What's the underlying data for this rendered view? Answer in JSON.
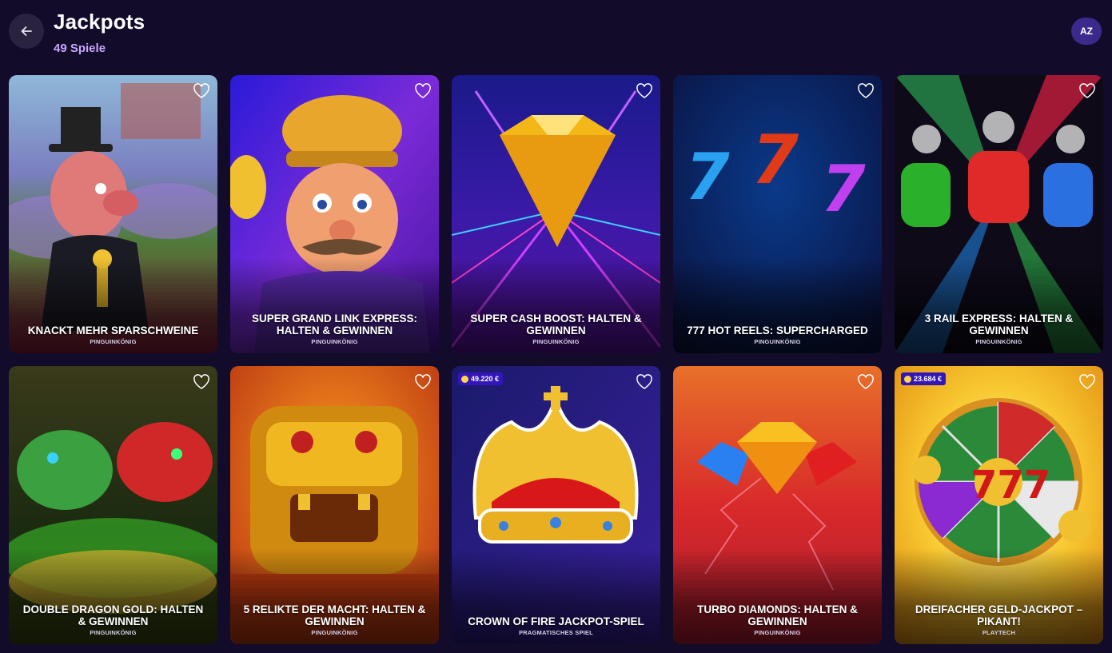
{
  "header": {
    "title": "Jackpots",
    "subtitle": "49 Spiele",
    "sort_label": "AZ"
  },
  "games": [
    {
      "name": "KNACKT MEHR SPARSCHWEINE",
      "provider": "PINGUINKÖNIG",
      "icon": "piggy-banker"
    },
    {
      "name": "SUPER GRAND LINK EXPRESS: HALTEN & GEWINNEN",
      "provider": "PINGUINKÖNIG",
      "icon": "conductor"
    },
    {
      "name": "SUPER CASH BOOST: HALTEN & GEWINNEN",
      "provider": "PINGUINKÖNIG",
      "icon": "diamond"
    },
    {
      "name": "777 HOT REELS: SUPERCHARGED",
      "provider": "PINGUINKÖNIG",
      "icon": "sevens"
    },
    {
      "name": "3 RAIL EXPRESS: HALTEN & GEWINNEN",
      "provider": "PINGUINKÖNIG",
      "icon": "trains"
    },
    {
      "name": "DOUBLE DRAGON GOLD: HALTEN & GEWINNEN",
      "provider": "PINGUINKÖNIG",
      "icon": "dragons"
    },
    {
      "name": "5 RELIKTE DER MACHT: HALTEN & GEWINNEN",
      "provider": "PINGUINKÖNIG",
      "icon": "golden-idol"
    },
    {
      "name": "CROWN OF FIRE JACKPOT-SPIEL",
      "provider": "PRAGMATISCHES SPIEL",
      "icon": "crown",
      "jackpot": "49.220 €"
    },
    {
      "name": "TURBO DIAMONDS: HALTEN & GEWINNEN",
      "provider": "PINGUINKÖNIG",
      "icon": "gems"
    },
    {
      "name": "DREIFACHER GELD-JACKPOT – PIKANT!",
      "provider": "PLAYTECH",
      "icon": "wheel",
      "jackpot": "23.684 €"
    }
  ],
  "colors": {
    "background": "#120b2a",
    "accent": "#c9a7ff",
    "badge": "#3216b8"
  }
}
